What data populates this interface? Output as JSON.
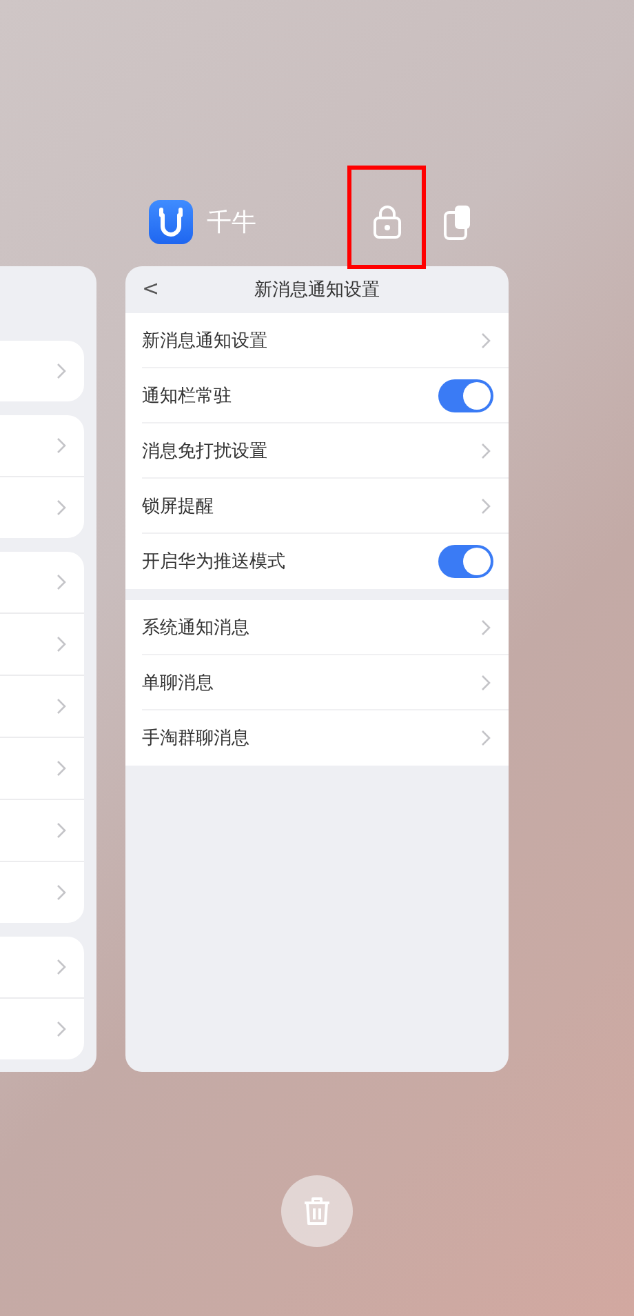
{
  "app": {
    "name": "千牛"
  },
  "card": {
    "back": "<",
    "title": "新消息通知设置",
    "groups": [
      {
        "rows": [
          {
            "kind": "link",
            "label": "新消息通知设置"
          },
          {
            "kind": "toggle",
            "label": "通知栏常驻",
            "on": true
          },
          {
            "kind": "link",
            "label": "消息免打扰设置"
          },
          {
            "kind": "link",
            "label": "锁屏提醒"
          },
          {
            "kind": "toggle",
            "label": "开启华为推送模式",
            "on": true
          }
        ]
      },
      {
        "rows": [
          {
            "kind": "link",
            "label": "系统通知消息"
          },
          {
            "kind": "link",
            "label": "单聊消息"
          },
          {
            "kind": "link",
            "label": "手淘群聊消息"
          }
        ]
      }
    ]
  }
}
